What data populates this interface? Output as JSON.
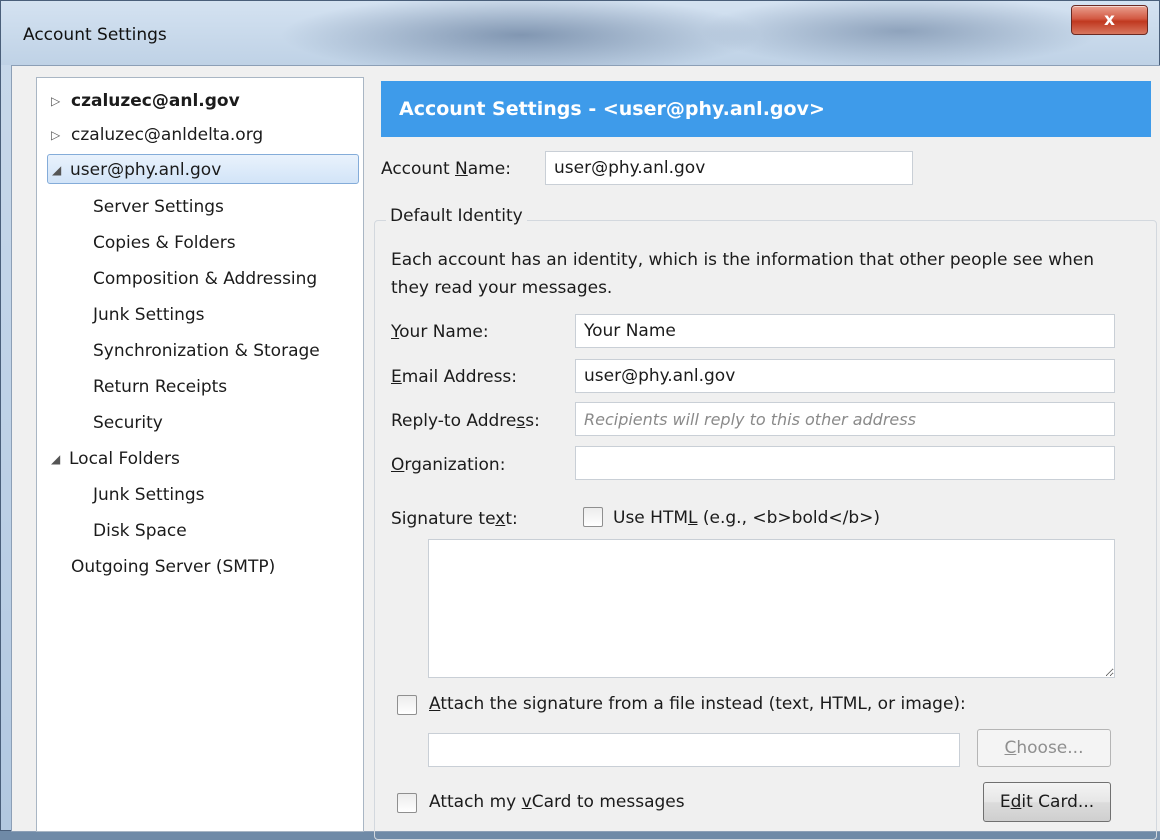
{
  "window": {
    "title": "Account Settings",
    "close_symbol": "x"
  },
  "tree": {
    "accounts": [
      {
        "label": "czaluzec@anl.gov",
        "expanded": false,
        "bold": true
      },
      {
        "label": "czaluzec@anldelta.org",
        "expanded": false,
        "bold": false
      },
      {
        "label": "user@phy.anl.gov",
        "expanded": true,
        "selected": true
      }
    ],
    "user_children": [
      "Server Settings",
      "Copies & Folders",
      "Composition & Addressing",
      "Junk Settings",
      "Synchronization & Storage",
      "Return Receipts",
      "Security"
    ],
    "local_folders": "Local Folders",
    "local_children": [
      "Junk Settings",
      "Disk Space"
    ],
    "outgoing": "Outgoing Server (SMTP)",
    "collapsed_arrow": "▷",
    "expanded_arrow": "◢"
  },
  "header": {
    "title": "Account Settings - <user@phy.anl.gov>"
  },
  "account_name": {
    "label_pre": "Account ",
    "label_u": "N",
    "label_post": "ame:",
    "value": "user@phy.anl.gov"
  },
  "identity": {
    "group_title": "Default Identity",
    "description": "Each account has an identity, which is the information that other people see when they read your messages.",
    "your_name": {
      "label_u": "Y",
      "label_post": "our Name:",
      "value": "Your Name"
    },
    "email": {
      "label_u": "E",
      "label_post": "mail Address:",
      "value": "user@phy.anl.gov"
    },
    "reply_to": {
      "label_pre": "Reply-to Addre",
      "label_u": "s",
      "label_post": "s:",
      "placeholder": "Recipients will reply to this other address"
    },
    "organization": {
      "label_u": "O",
      "label_post": "rganization:",
      "value": ""
    },
    "signature": {
      "label_pre": "Signature te",
      "label_u": "x",
      "label_post": "t:",
      "use_html_pre": "Use HTM",
      "use_html_u": "L",
      "use_html_post": " (e.g., <b>bold</b>)",
      "use_html_checked": false,
      "text": ""
    },
    "attach_file": {
      "label_u": "A",
      "label_post": "ttach the signature from a file instead (text, HTML, or image):",
      "checked": false,
      "path": "",
      "choose_pre": "",
      "choose_u": "C",
      "choose_post": "hoose..."
    },
    "vcard": {
      "label_pre": "Attach my ",
      "label_u": "v",
      "label_post": "Card to messages",
      "checked": false,
      "edit_pre": "E",
      "edit_u": "d",
      "edit_post": "it Card..."
    }
  }
}
